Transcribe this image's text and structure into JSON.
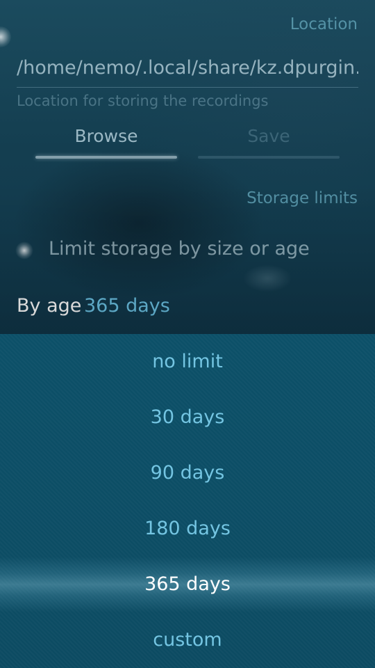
{
  "location": {
    "header": "Location",
    "path_value": "/home/nemo/.local/share/kz.dpurgin.callrecorder",
    "path_hint": "Location for storing the recordings",
    "browse_label": "Browse",
    "save_label": "Save"
  },
  "storage": {
    "header": "Storage limits",
    "limit_switch_label": "Limit storage by size or age",
    "limit_enabled": true,
    "by_age_label": "By age",
    "by_age_value": "365 days"
  },
  "menu": {
    "items": [
      {
        "label": "no limit",
        "selected": false
      },
      {
        "label": "30 days",
        "selected": false
      },
      {
        "label": "90 days",
        "selected": false
      },
      {
        "label": "180 days",
        "selected": false
      },
      {
        "label": "365 days",
        "selected": true
      },
      {
        "label": "custom",
        "selected": false
      }
    ]
  },
  "colors": {
    "accent": "#6cc4e6",
    "highlight": "#ffffff",
    "menu_background": "#0d4f66"
  }
}
